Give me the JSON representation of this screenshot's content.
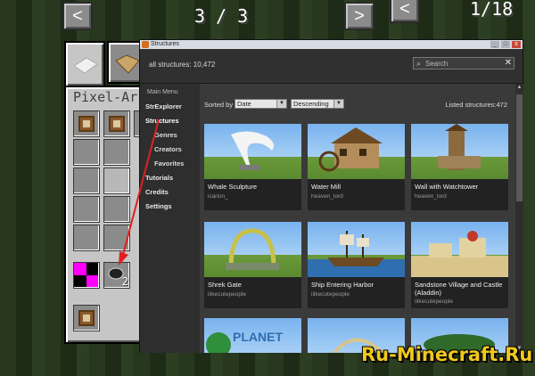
{
  "minecraft": {
    "left_pager": {
      "prev": "<",
      "text": "3 / 3",
      "next": ">"
    },
    "right_pager": {
      "prev": "<",
      "text": "1/18"
    },
    "panel_title": "Pixel-Ar",
    "slot_count": "2"
  },
  "window": {
    "title": "Structures",
    "header": {
      "count_label": "all structures: 10,472",
      "search_placeholder": "Search",
      "clear": "✕"
    },
    "sidebar": {
      "heading": "Main Menu",
      "items": [
        {
          "label": "StrExplorer"
        },
        {
          "label": "Structures"
        },
        {
          "label": "Genres"
        },
        {
          "label": "Creators"
        },
        {
          "label": "Favorites"
        },
        {
          "label": "Tutorials"
        },
        {
          "label": "Credits"
        },
        {
          "label": "Settings"
        }
      ]
    },
    "toolbar": {
      "sorted_by_label": "Sorted by",
      "sort_field": "Date",
      "sort_order": "Descending",
      "listed": "Listed structures:472"
    },
    "cards": [
      {
        "name": "Whale Sculpture",
        "author": "icarion_"
      },
      {
        "name": "Water Mill",
        "author": "heaven_lord"
      },
      {
        "name": "Wall with Watchtower",
        "author": "heaven_lord"
      },
      {
        "name": "Shrek Gate",
        "author": "iilkecutepeople"
      },
      {
        "name": "Ship Entering Harbor",
        "author": "iilkecutepeople"
      },
      {
        "name": "Sandstone Village and Castle (Aladdin)",
        "author": "iilkecutepeople"
      },
      {
        "name": "",
        "author": ""
      },
      {
        "name": "",
        "author": ""
      },
      {
        "name": "",
        "author": ""
      }
    ],
    "third_row_thumb_text": "PLANET"
  },
  "watermark": "Ru-Minecraft.Ru",
  "colors": {
    "accent_red": "#e02020",
    "watermark": "#f0c81e"
  }
}
